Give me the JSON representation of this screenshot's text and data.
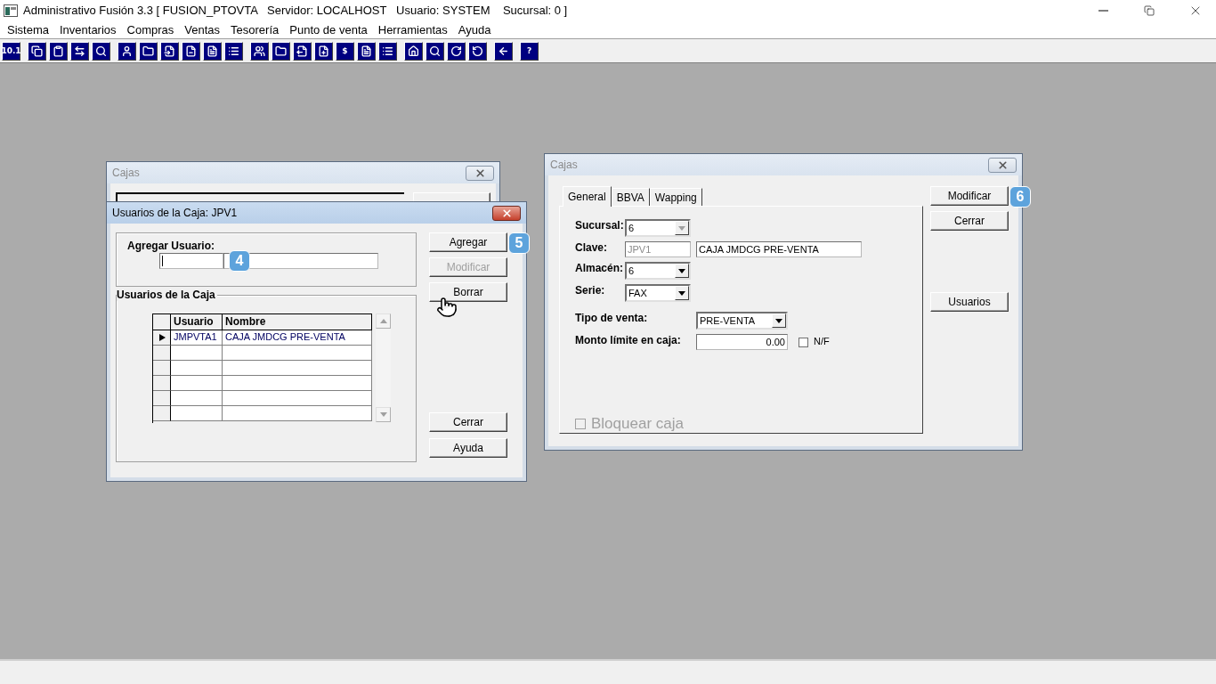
{
  "app_window": {
    "title": "Administrativo Fusión 3.3 [ FUSION_PTOVTA   Servidor: LOCALHOST   Usuario: SYSTEM    Sucursal: 0 ]",
    "menu": [
      "Sistema",
      "Inventarios",
      "Compras",
      "Ventas",
      "Tesorería",
      "Punto de venta",
      "Herramientas",
      "Ayuda"
    ],
    "toolbar": [
      [
        {
          "kind": "text",
          "text": "10.1"
        }
      ],
      [
        {
          "kind": "copy"
        },
        {
          "kind": "clipboard"
        },
        {
          "kind": "swap"
        },
        {
          "kind": "search"
        }
      ],
      [
        {
          "kind": "user"
        },
        {
          "kind": "folder"
        },
        {
          "kind": "doc-in"
        },
        {
          "kind": "doc-minus"
        },
        {
          "kind": "doc"
        },
        {
          "kind": "list"
        }
      ],
      [
        {
          "kind": "users"
        },
        {
          "kind": "folder"
        },
        {
          "kind": "doc-out"
        },
        {
          "kind": "doc-plus"
        },
        {
          "kind": "text",
          "text": "$"
        },
        {
          "kind": "doc"
        },
        {
          "kind": "list"
        }
      ],
      [
        {
          "kind": "home"
        },
        {
          "kind": "search"
        },
        {
          "kind": "redo"
        },
        {
          "kind": "undo"
        }
      ],
      [
        {
          "kind": "arrow-left"
        }
      ],
      [
        {
          "kind": "text",
          "text": "?"
        }
      ]
    ]
  },
  "background_window": {
    "title": "Cajas",
    "active": false
  },
  "users_dialog": {
    "title": "Usuarios de la Caja: JPV1",
    "active": true,
    "add_group": {
      "label": "Agregar Usuario:",
      "callout": "4"
    },
    "list_group": {
      "title": "Usuarios de la Caja",
      "columns": [
        "Usuario",
        "Nombre"
      ],
      "rows": [
        {
          "current": true,
          "cells": [
            "JMPVTA1",
            "CAJA JMDCG PRE-VENTA"
          ]
        },
        {
          "current": false
        },
        {
          "current": false
        },
        {
          "current": false
        },
        {
          "current": false
        },
        {
          "current": false
        }
      ]
    },
    "buttons": [
      {
        "label": "Agregar",
        "disabled": false,
        "callout": "5",
        "kind": "top"
      },
      {
        "label": "Modificar",
        "disabled": true,
        "kind": "top"
      },
      {
        "label": "Borrar",
        "disabled": false,
        "kind": "top"
      },
      {
        "label": "Cerrar",
        "disabled": false,
        "kind": "bottom"
      },
      {
        "label": "Ayuda",
        "disabled": false,
        "kind": "bottom"
      }
    ]
  },
  "cajas_window": {
    "title": "Cajas",
    "active": false,
    "tabs": [
      {
        "label": "General",
        "selected": true
      },
      {
        "label": "BBVA",
        "selected": false
      },
      {
        "label": "Wapping",
        "selected": false
      }
    ],
    "form": [
      {
        "kind": "combo",
        "label": "Sucursal:",
        "value": "6",
        "disabled": true
      },
      {
        "kind": "code-name",
        "label": "Clave:",
        "code": "JPV1",
        "name": "CAJA JMDCG PRE-VENTA"
      },
      {
        "kind": "combo",
        "label": "Almacén:",
        "value": "6",
        "disabled": false
      },
      {
        "kind": "combo",
        "label": "Serie:",
        "value": "FAX",
        "disabled": false
      },
      {
        "kind": "wide-combo",
        "label": "Tipo de venta:",
        "value": "PRE-VENTA"
      },
      {
        "kind": "amount",
        "label": "Monto límite en caja:",
        "value": "0.00",
        "check_label": "N/F",
        "checked": false
      }
    ],
    "block_checkbox": {
      "label": "Bloquear caja",
      "checked": false,
      "disabled": true
    },
    "buttons": [
      {
        "label": "Modificar",
        "disabled": false,
        "callout": "6",
        "kind": "top"
      },
      {
        "label": "Cerrar",
        "disabled": false,
        "kind": "top"
      },
      {
        "label": "Usuarios",
        "disabled": false,
        "kind": "bottom"
      }
    ]
  }
}
